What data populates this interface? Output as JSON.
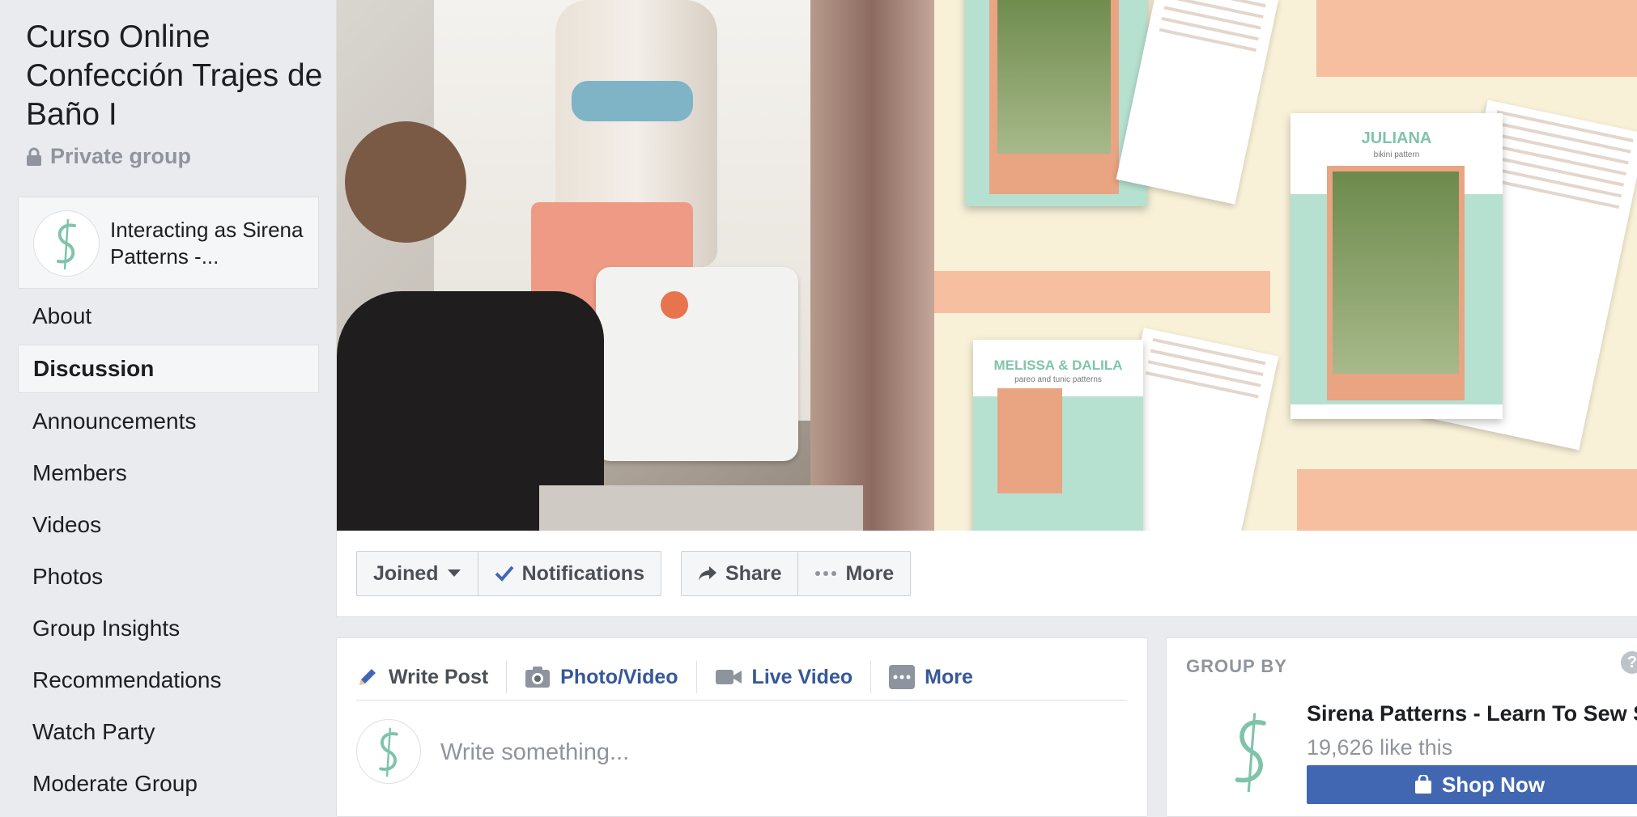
{
  "group": {
    "title": "Curso Online Confección Trajes de Baño I",
    "privacy": "Private group"
  },
  "interacting": {
    "text": "Interacting as Sirena Patterns -..."
  },
  "nav": {
    "items": [
      {
        "label": "About"
      },
      {
        "label": "Discussion",
        "active": true
      },
      {
        "label": "Announcements"
      },
      {
        "label": "Members"
      },
      {
        "label": "Videos"
      },
      {
        "label": "Photos"
      },
      {
        "label": "Group Insights"
      },
      {
        "label": "Recommendations"
      },
      {
        "label": "Watch Party"
      },
      {
        "label": "Moderate Group"
      }
    ]
  },
  "cover": {
    "juliana_title": "JULIANA",
    "juliana_sub": "bikini pattern",
    "melissa_title": "MELISSA & DALILA",
    "melissa_sub": "pareo and tunic patterns"
  },
  "actions": {
    "joined": "Joined",
    "notifications": "Notifications",
    "share": "Share",
    "more": "More"
  },
  "composer": {
    "tabs": {
      "write_post": "Write Post",
      "photo_video": "Photo/Video",
      "live_video": "Live Video",
      "more": "More"
    },
    "placeholder": "Write something..."
  },
  "group_by": {
    "title": "GROUP BY",
    "help": "?",
    "page_name": "Sirena Patterns - Learn To Sew S",
    "likes": "19,626 like this",
    "shop_now": "Shop Now"
  },
  "colors": {
    "background": "#e9ebee",
    "link": "#365899",
    "button_blue": "#4267b2",
    "muted": "#90949c",
    "mint": "#7fc4aa",
    "peach": "#f5bfa0"
  }
}
